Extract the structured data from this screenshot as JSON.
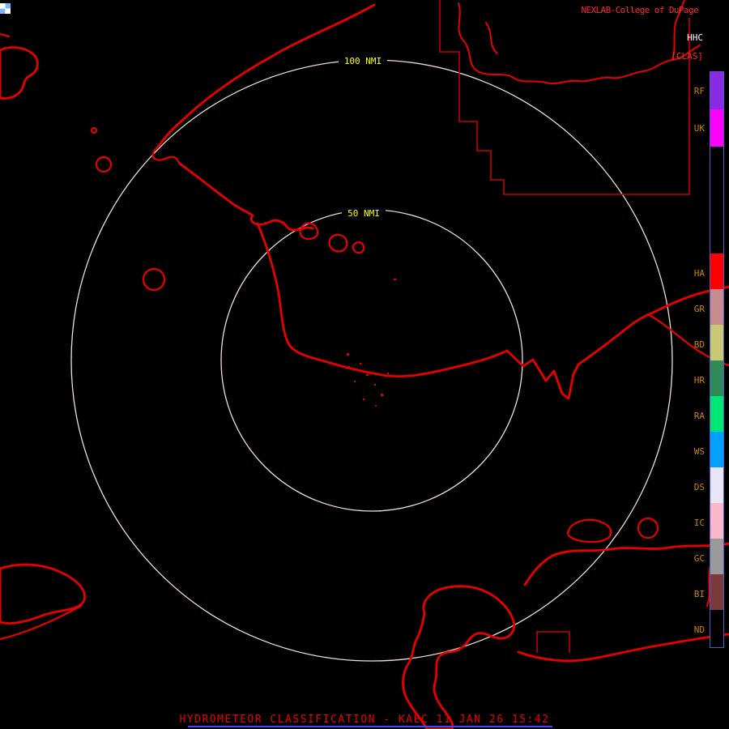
{
  "colors": {
    "background": "#000000",
    "map_line": "#E60000",
    "border_line": "#C40000",
    "ring": "#F2DED6",
    "ring_label": "#FFFF00",
    "brand": "#FF2A2A",
    "product_code": "#FFFFFF",
    "classification": "#FF2A2A",
    "legend_label": "#CC8400",
    "legend_border": "#5555CC",
    "title": "#E60000",
    "underline": "#4444FF"
  },
  "header": {
    "brand": "NEXLAB-College of DuPage",
    "product_code": "HHC",
    "classification": "[CLAS]"
  },
  "rings": {
    "outer_label": "100 NMI",
    "inner_label": "50 NMI"
  },
  "legend": {
    "items": [
      {
        "label": "RF",
        "color": "#8A2BE2"
      },
      {
        "label": "UK",
        "color": "#FF00FF"
      },
      {
        "label": "HA",
        "color": "#FF0000"
      },
      {
        "label": "GR",
        "color": "#C98C8C"
      },
      {
        "label": "BD",
        "color": "#C9C973"
      },
      {
        "label": "HR",
        "color": "#2E8B57"
      },
      {
        "label": "RA",
        "color": "#00E673"
      },
      {
        "label": "WS",
        "color": "#00A2FF"
      },
      {
        "label": "DS",
        "color": "#E8E6F5"
      },
      {
        "label": "IC",
        "color": "#F8B8C8"
      },
      {
        "label": "GC",
        "color": "#9A9A9A"
      },
      {
        "label": "BI",
        "color": "#7A3B3B"
      },
      {
        "label": "ND",
        "color": "#000000"
      }
    ]
  },
  "footer": {
    "title": "HYDROMETEOR CLASSIFICATION - KAEC 11 JAN 26 15:42"
  }
}
